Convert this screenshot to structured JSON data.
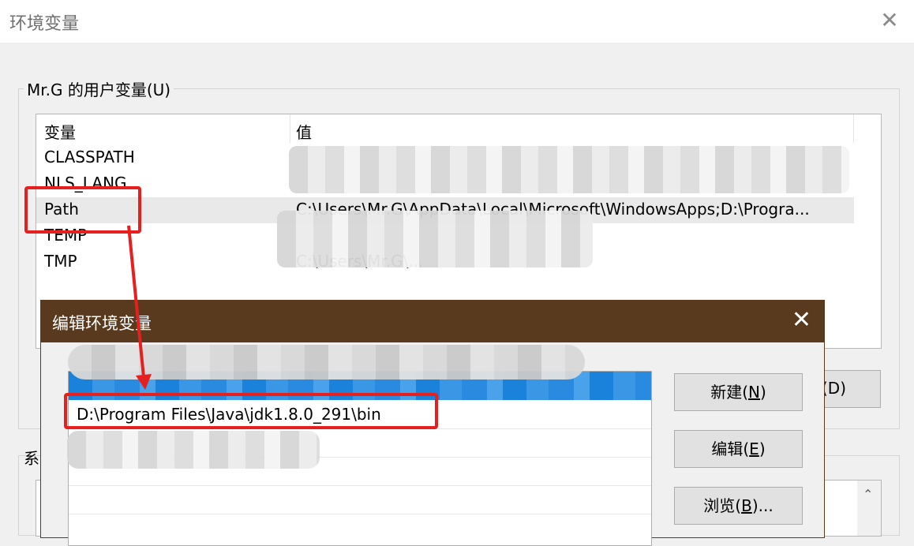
{
  "window": {
    "title": "环境变量",
    "close_glyph": "✕"
  },
  "user_vars": {
    "group_label": "Mr.G 的用户变量(U)",
    "columns": {
      "name": "变量",
      "value": "值"
    },
    "rows": [
      {
        "name": "CLASSPATH",
        "value": ""
      },
      {
        "name": "NLS_LANG",
        "value": ""
      },
      {
        "name": "Path",
        "value": "C:\\Users\\Mr.G\\AppData\\Local\\Microsoft\\WindowsApps;D:\\Progra..."
      },
      {
        "name": "TEMP",
        "value": ""
      },
      {
        "name": "TMP",
        "value": "C:\\Users\\Mr.G\\..."
      }
    ],
    "delete_button_partial": "(D)"
  },
  "system_vars": {
    "group_label_partial": "系"
  },
  "edit_dialog": {
    "title": "编辑环境变量",
    "close_glyph": "✕",
    "entries": [
      "D:\\Program Files\\Java\\jdk1.8.0_291\\bin"
    ],
    "buttons": {
      "new": {
        "label": "新建(",
        "mnemonic": "N",
        "suffix": ")"
      },
      "edit": {
        "label": "编辑(",
        "mnemonic": "E",
        "suffix": ")"
      },
      "browse": {
        "label": "浏览(",
        "mnemonic": "B",
        "suffix": ")..."
      }
    }
  },
  "colors": {
    "dialog_titlebar": "#5a3a1e",
    "selection": "#1b82db",
    "annotation": "#e5201f"
  },
  "icons": {
    "scroll_up": "scroll-up-icon",
    "close": "close-icon"
  }
}
